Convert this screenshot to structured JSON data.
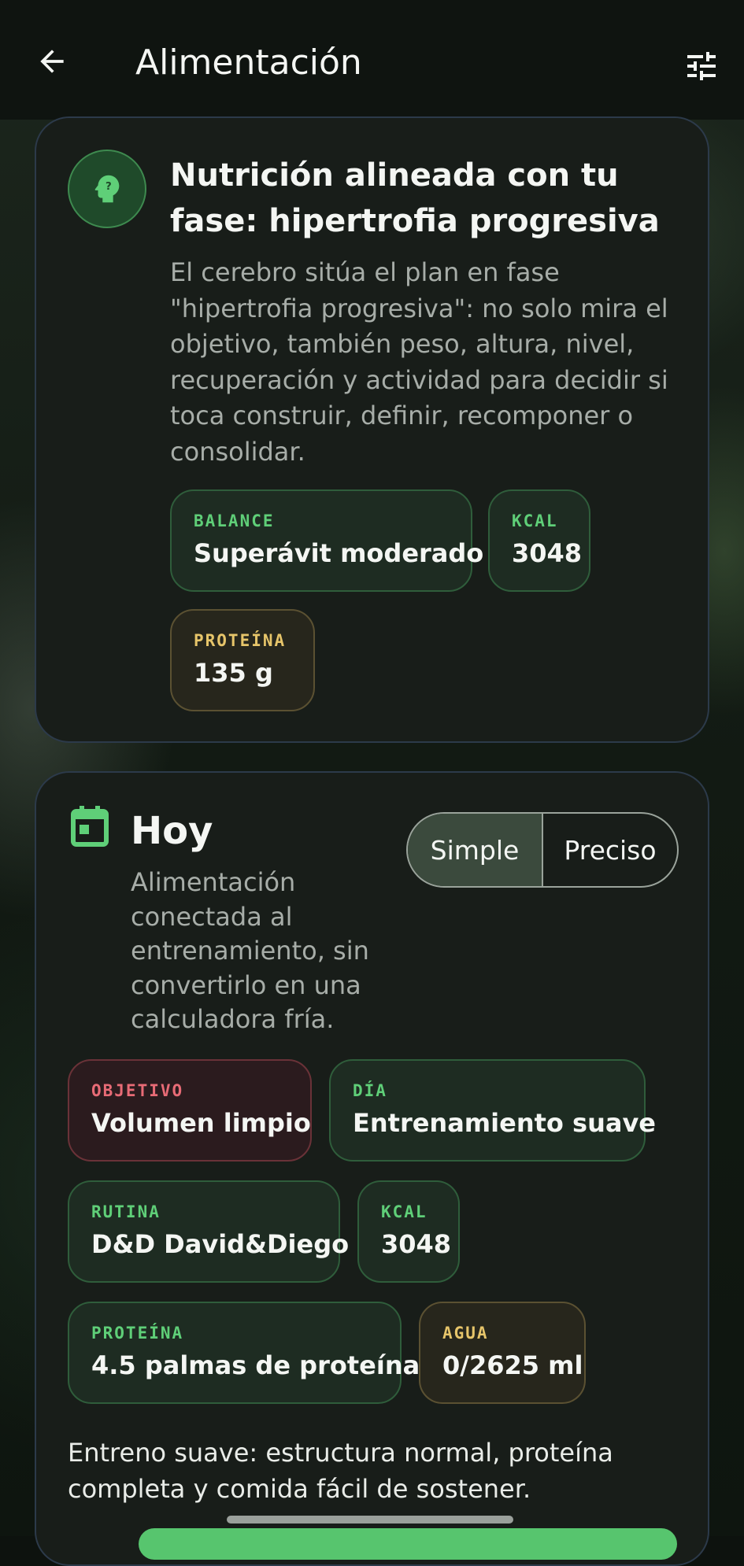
{
  "appbar": {
    "title": "Alimentación",
    "back_icon": "arrow-left-icon",
    "filter_icon": "tune-sliders-icon"
  },
  "phase_card": {
    "icon": "brain-question-icon",
    "title": "Nutrición alineada con tu fase: hipertrofia progresiva",
    "description": "El cerebro sitúa el plan en fase \"hipertrofia progresiva\": no solo mira el objetivo, también peso, altura, nivel, recuperación y actividad para decidir si toca construir, definir, recomponer o consolidar.",
    "chips": [
      {
        "label": "BALANCE",
        "value": "Superávit moderado",
        "tone": "green"
      },
      {
        "label": "KCAL",
        "value": "3048",
        "tone": "green"
      },
      {
        "label": "PROTEÍNA",
        "value": "135 g",
        "tone": "gold"
      }
    ]
  },
  "today_card": {
    "icon": "calendar-icon",
    "title": "Hoy",
    "description": "Alimentación conectada al entrenamiento, sin convertirlo en una calculadora fría.",
    "mode_toggle": {
      "options": [
        "Simple",
        "Preciso"
      ],
      "selected": "Simple"
    },
    "chips": [
      {
        "label": "OBJETIVO",
        "value": "Volumen limpio",
        "tone": "red"
      },
      {
        "label": "DÍA",
        "value": "Entrenamiento suave",
        "tone": "green"
      },
      {
        "label": "RUTINA",
        "value": "D&D David&Diego",
        "tone": "green"
      },
      {
        "label": "KCAL",
        "value": "3048",
        "tone": "green"
      },
      {
        "label": "PROTEÍNA",
        "value": "4.5 palmas de proteína",
        "tone": "green"
      },
      {
        "label": "AGUA",
        "value": "0/2625 ml",
        "tone": "gold"
      }
    ],
    "note": "Entreno suave: estructura normal, proteína completa y comida fácil de sostener."
  },
  "colors": {
    "accent_green": "#5fcf78",
    "accent_gold": "#e7c56a",
    "accent_red": "#e86b76",
    "card_bg": "#181d19"
  }
}
